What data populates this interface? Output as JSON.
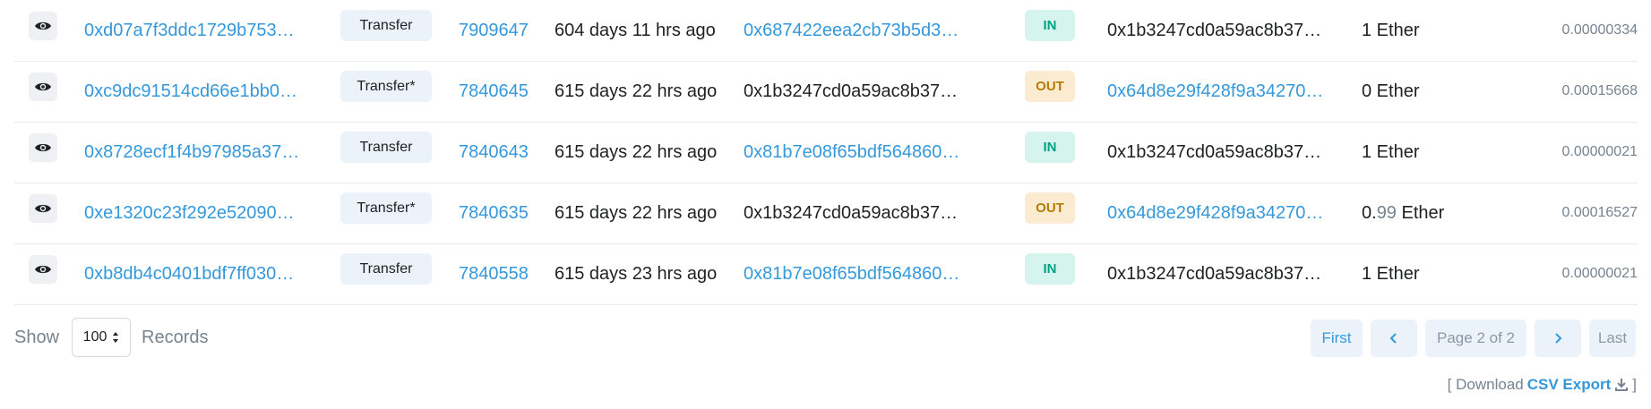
{
  "transactions": [
    {
      "hash": "0xd07a7f3ddc1729b753…",
      "method": "Transfer",
      "block": "7909647",
      "age": "604 days 11 hrs ago",
      "from": "0x687422eea2cb73b5d3…",
      "from_is_link": true,
      "direction": "IN",
      "to": "0x1b3247cd0a59ac8b37…",
      "to_is_link": false,
      "value_main": "1",
      "value_decimals": "",
      "value_unit": " Ether",
      "fee": "0.00000334"
    },
    {
      "hash": "0xc9dc91514cd66e1bb0…",
      "method": "Transfer*",
      "block": "7840645",
      "age": "615 days 22 hrs ago",
      "from": "0x1b3247cd0a59ac8b37…",
      "from_is_link": false,
      "direction": "OUT",
      "to": "0x64d8e29f428f9a34270…",
      "to_is_link": true,
      "value_main": "0",
      "value_decimals": "",
      "value_unit": " Ether",
      "fee": "0.00015668"
    },
    {
      "hash": "0x8728ecf1f4b97985a37…",
      "method": "Transfer",
      "block": "7840643",
      "age": "615 days 22 hrs ago",
      "from": "0x81b7e08f65bdf564860…",
      "from_is_link": true,
      "direction": "IN",
      "to": "0x1b3247cd0a59ac8b37…",
      "to_is_link": false,
      "value_main": "1",
      "value_decimals": "",
      "value_unit": " Ether",
      "fee": "0.00000021"
    },
    {
      "hash": "0xe1320c23f292e52090…",
      "method": "Transfer*",
      "block": "7840635",
      "age": "615 days 22 hrs ago",
      "from": "0x1b3247cd0a59ac8b37…",
      "from_is_link": false,
      "direction": "OUT",
      "to": "0x64d8e29f428f9a34270…",
      "to_is_link": true,
      "value_main": "0.",
      "value_decimals": "99",
      "value_unit": " Ether",
      "fee": "0.00016527"
    },
    {
      "hash": "0xb8db4c0401bdf7ff030…",
      "method": "Transfer",
      "block": "7840558",
      "age": "615 days 23 hrs ago",
      "from": "0x81b7e08f65bdf564860…",
      "from_is_link": true,
      "direction": "IN",
      "to": "0x1b3247cd0a59ac8b37…",
      "to_is_link": false,
      "value_main": "1",
      "value_decimals": "",
      "value_unit": " Ether",
      "fee": "0.00000021"
    }
  ],
  "footer": {
    "show_label": "Show",
    "records_value": "100",
    "records_label": "Records"
  },
  "pagination": {
    "first": "First",
    "prev_icon": "chevron-left-icon",
    "page_text": "Page 2 of 2",
    "next_icon": "chevron-right-icon",
    "last": "Last"
  },
  "export": {
    "prefix": "[ Download ",
    "link": "CSV Export",
    "icon": "download-icon",
    "suffix": " ]"
  },
  "colors": {
    "link": "#3498db",
    "in_badge_bg": "#d5f4ee",
    "in_badge_text": "#00a186",
    "out_badge_bg": "#fbecd1",
    "out_badge_text": "#b47d00"
  }
}
